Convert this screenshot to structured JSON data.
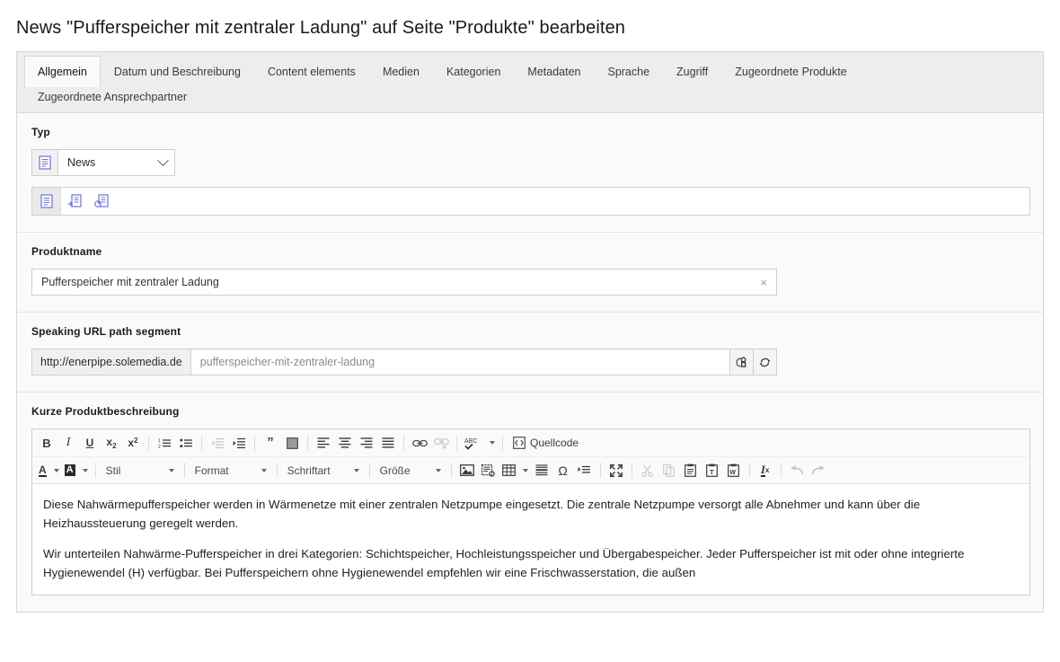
{
  "page": {
    "title": "News \"Pufferspeicher mit zentraler Ladung\" auf Seite \"Produkte\" bearbeiten"
  },
  "tabs": {
    "row1": [
      {
        "label": "Allgemein",
        "active": true
      },
      {
        "label": "Datum und Beschreibung",
        "active": false
      },
      {
        "label": "Content elements",
        "active": false
      },
      {
        "label": "Medien",
        "active": false
      },
      {
        "label": "Kategorien",
        "active": false
      },
      {
        "label": "Metadaten",
        "active": false
      },
      {
        "label": "Sprache",
        "active": false
      },
      {
        "label": "Zugriff",
        "active": false
      },
      {
        "label": "Zugeordnete Produkte",
        "active": false
      }
    ],
    "row2": [
      {
        "label": "Zugeordnete Ansprechpartner",
        "active": false
      }
    ]
  },
  "typ": {
    "label": "Typ",
    "selected": "News",
    "icons": {
      "select_prefix": "news-document-icon",
      "toolbar": [
        {
          "name": "news-type-default-icon",
          "active": true
        },
        {
          "name": "news-type-internal-link-icon",
          "active": false
        },
        {
          "name": "news-type-external-link-icon",
          "active": false
        }
      ]
    }
  },
  "produktname": {
    "label": "Produktname",
    "value": "Pufferspeicher mit zentraler Ladung",
    "clear_glyph": "×"
  },
  "speaking_url": {
    "label": "Speaking URL path segment",
    "prefix": "http://enerpipe.solemedia.de",
    "placeholder": "pufferspeicher-mit-zentraler-ladung",
    "buttons": [
      {
        "name": "lock-link-icon"
      },
      {
        "name": "recreate-refresh-icon"
      }
    ]
  },
  "rte": {
    "label": "Kurze Produktbeschreibung",
    "toolbar_row1": [
      {
        "name": "bold-icon",
        "glyph": "B",
        "disabled": false
      },
      {
        "name": "italic-icon",
        "glyph": "I",
        "disabled": false
      },
      {
        "name": "underline-icon",
        "glyph": "U",
        "disabled": false
      },
      {
        "name": "subscript-icon",
        "glyph": "x₂",
        "disabled": false
      },
      {
        "name": "superscript-icon",
        "glyph": "x²",
        "disabled": false
      },
      {
        "sep": true
      },
      {
        "name": "numbered-list-icon",
        "glyph": "",
        "disabled": false
      },
      {
        "name": "bulleted-list-icon",
        "glyph": "",
        "disabled": false
      },
      {
        "sep": true
      },
      {
        "name": "decrease-indent-icon",
        "glyph": "",
        "disabled": true
      },
      {
        "name": "increase-indent-icon",
        "glyph": "",
        "disabled": false
      },
      {
        "sep": true
      },
      {
        "name": "blockquote-icon",
        "glyph": "”",
        "disabled": false
      },
      {
        "name": "div-container-icon",
        "glyph": "",
        "disabled": false
      },
      {
        "sep": true
      },
      {
        "name": "align-left-icon",
        "glyph": "",
        "disabled": false
      },
      {
        "name": "align-center-icon",
        "glyph": "",
        "disabled": false
      },
      {
        "name": "align-right-icon",
        "glyph": "",
        "disabled": false
      },
      {
        "name": "align-justify-icon",
        "glyph": "",
        "disabled": false
      },
      {
        "sep": true
      },
      {
        "name": "link-icon",
        "glyph": "",
        "disabled": false
      },
      {
        "name": "unlink-icon",
        "glyph": "",
        "disabled": true
      },
      {
        "sep": true
      },
      {
        "name": "spellcheck-icon",
        "glyph": "ABC",
        "disabled": false
      },
      {
        "sep": true
      },
      {
        "name": "source-code-button",
        "glyph": "Quellcode",
        "disabled": false
      }
    ],
    "toolbar_row2": [
      {
        "name": "text-color-icon",
        "glyph": "A",
        "disabled": false
      },
      {
        "name": "background-color-icon",
        "glyph": "A",
        "disabled": false
      },
      {
        "sep": true
      },
      {
        "name": "styles-dropdown",
        "glyph": "Stil",
        "disabled": false
      },
      {
        "sep": true
      },
      {
        "name": "format-dropdown",
        "glyph": "Format",
        "disabled": false
      },
      {
        "sep": true
      },
      {
        "name": "font-dropdown",
        "glyph": "Schriftart",
        "disabled": false
      },
      {
        "sep": true
      },
      {
        "name": "fontsize-dropdown",
        "glyph": "Größe",
        "disabled": false
      },
      {
        "sep": true
      },
      {
        "name": "image-icon",
        "glyph": "",
        "disabled": false
      },
      {
        "name": "templates-icon",
        "glyph": "",
        "disabled": false
      },
      {
        "name": "table-icon",
        "glyph": "",
        "disabled": false
      },
      {
        "name": "horizontal-rule-icon",
        "glyph": "",
        "disabled": false
      },
      {
        "name": "special-character-icon",
        "glyph": "Ω",
        "disabled": false
      },
      {
        "name": "page-break-icon",
        "glyph": "",
        "disabled": false
      },
      {
        "sep": true
      },
      {
        "name": "maximize-icon",
        "glyph": "",
        "disabled": false
      },
      {
        "sep": true
      },
      {
        "name": "cut-icon",
        "glyph": "",
        "disabled": true
      },
      {
        "name": "copy-icon",
        "glyph": "",
        "disabled": true
      },
      {
        "name": "paste-icon",
        "glyph": "",
        "disabled": false
      },
      {
        "name": "paste-as-text-icon",
        "glyph": "T",
        "disabled": false
      },
      {
        "name": "paste-from-word-icon",
        "glyph": "W",
        "disabled": false
      },
      {
        "sep": true
      },
      {
        "name": "remove-format-icon",
        "glyph": "I",
        "disabled": false
      },
      {
        "sep": true
      },
      {
        "name": "undo-icon",
        "glyph": "",
        "disabled": true
      },
      {
        "name": "redo-icon",
        "glyph": "",
        "disabled": true
      }
    ],
    "labels": {
      "stil": "Stil",
      "format": "Format",
      "schriftart": "Schriftart",
      "groesse": "Größe",
      "quellcode": "Quellcode",
      "abc": "ABC"
    },
    "content": {
      "p1": "Diese Nahwärmepufferspeicher werden in Wärmenetze mit einer zentralen Netzpumpe eingesetzt. Die zentrale Netzpumpe versorgt alle Abnehmer und kann über die Heizhaussteuerung geregelt werden.",
      "p2": "Wir unterteilen Nahwärme-Pufferspeicher in drei Kategorien: Schichtspeicher, Hochleistungsspeicher und Übergabespeicher. Jeder Pufferspeicher ist mit oder ohne integrierte Hygienewendel (H) verfügbar. Bei Pufferspeichern ohne Hygienewendel empfehlen wir eine Frischwasserstation, die außen"
    }
  },
  "colors": {
    "icon_blue": "#6f73d2",
    "panel_bg": "#fafafa",
    "tabbar_bg": "#ededed",
    "border": "#cfcfcf"
  }
}
